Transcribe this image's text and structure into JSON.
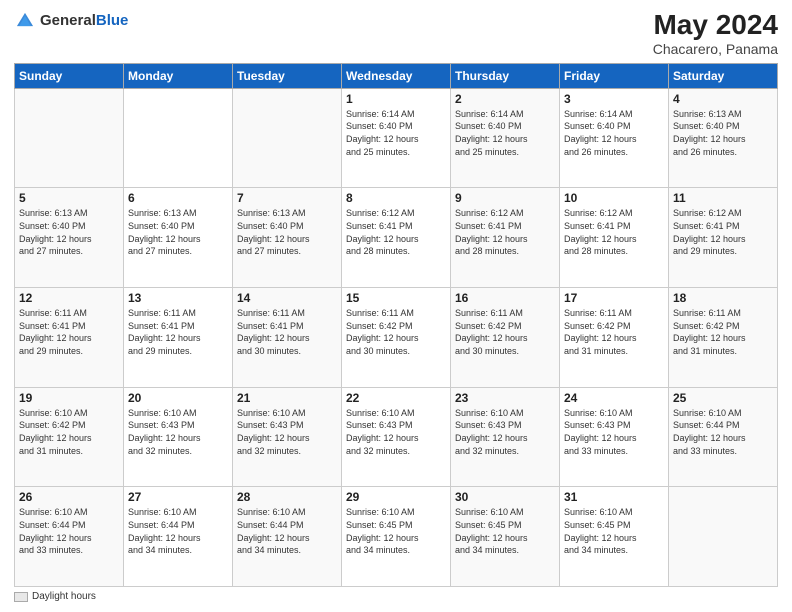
{
  "header": {
    "logo_line1": "General",
    "logo_line2": "Blue",
    "month": "May 2024",
    "location": "Chacarero, Panama"
  },
  "days_of_week": [
    "Sunday",
    "Monday",
    "Tuesday",
    "Wednesday",
    "Thursday",
    "Friday",
    "Saturday"
  ],
  "footer": {
    "legend_label": "Daylight hours"
  },
  "weeks": [
    [
      {
        "day": "",
        "info": ""
      },
      {
        "day": "",
        "info": ""
      },
      {
        "day": "",
        "info": ""
      },
      {
        "day": "1",
        "info": "Sunrise: 6:14 AM\nSunset: 6:40 PM\nDaylight: 12 hours\nand 25 minutes."
      },
      {
        "day": "2",
        "info": "Sunrise: 6:14 AM\nSunset: 6:40 PM\nDaylight: 12 hours\nand 25 minutes."
      },
      {
        "day": "3",
        "info": "Sunrise: 6:14 AM\nSunset: 6:40 PM\nDaylight: 12 hours\nand 26 minutes."
      },
      {
        "day": "4",
        "info": "Sunrise: 6:13 AM\nSunset: 6:40 PM\nDaylight: 12 hours\nand 26 minutes."
      }
    ],
    [
      {
        "day": "5",
        "info": "Sunrise: 6:13 AM\nSunset: 6:40 PM\nDaylight: 12 hours\nand 27 minutes."
      },
      {
        "day": "6",
        "info": "Sunrise: 6:13 AM\nSunset: 6:40 PM\nDaylight: 12 hours\nand 27 minutes."
      },
      {
        "day": "7",
        "info": "Sunrise: 6:13 AM\nSunset: 6:40 PM\nDaylight: 12 hours\nand 27 minutes."
      },
      {
        "day": "8",
        "info": "Sunrise: 6:12 AM\nSunset: 6:41 PM\nDaylight: 12 hours\nand 28 minutes."
      },
      {
        "day": "9",
        "info": "Sunrise: 6:12 AM\nSunset: 6:41 PM\nDaylight: 12 hours\nand 28 minutes."
      },
      {
        "day": "10",
        "info": "Sunrise: 6:12 AM\nSunset: 6:41 PM\nDaylight: 12 hours\nand 28 minutes."
      },
      {
        "day": "11",
        "info": "Sunrise: 6:12 AM\nSunset: 6:41 PM\nDaylight: 12 hours\nand 29 minutes."
      }
    ],
    [
      {
        "day": "12",
        "info": "Sunrise: 6:11 AM\nSunset: 6:41 PM\nDaylight: 12 hours\nand 29 minutes."
      },
      {
        "day": "13",
        "info": "Sunrise: 6:11 AM\nSunset: 6:41 PM\nDaylight: 12 hours\nand 29 minutes."
      },
      {
        "day": "14",
        "info": "Sunrise: 6:11 AM\nSunset: 6:41 PM\nDaylight: 12 hours\nand 30 minutes."
      },
      {
        "day": "15",
        "info": "Sunrise: 6:11 AM\nSunset: 6:42 PM\nDaylight: 12 hours\nand 30 minutes."
      },
      {
        "day": "16",
        "info": "Sunrise: 6:11 AM\nSunset: 6:42 PM\nDaylight: 12 hours\nand 30 minutes."
      },
      {
        "day": "17",
        "info": "Sunrise: 6:11 AM\nSunset: 6:42 PM\nDaylight: 12 hours\nand 31 minutes."
      },
      {
        "day": "18",
        "info": "Sunrise: 6:11 AM\nSunset: 6:42 PM\nDaylight: 12 hours\nand 31 minutes."
      }
    ],
    [
      {
        "day": "19",
        "info": "Sunrise: 6:10 AM\nSunset: 6:42 PM\nDaylight: 12 hours\nand 31 minutes."
      },
      {
        "day": "20",
        "info": "Sunrise: 6:10 AM\nSunset: 6:43 PM\nDaylight: 12 hours\nand 32 minutes."
      },
      {
        "day": "21",
        "info": "Sunrise: 6:10 AM\nSunset: 6:43 PM\nDaylight: 12 hours\nand 32 minutes."
      },
      {
        "day": "22",
        "info": "Sunrise: 6:10 AM\nSunset: 6:43 PM\nDaylight: 12 hours\nand 32 minutes."
      },
      {
        "day": "23",
        "info": "Sunrise: 6:10 AM\nSunset: 6:43 PM\nDaylight: 12 hours\nand 32 minutes."
      },
      {
        "day": "24",
        "info": "Sunrise: 6:10 AM\nSunset: 6:43 PM\nDaylight: 12 hours\nand 33 minutes."
      },
      {
        "day": "25",
        "info": "Sunrise: 6:10 AM\nSunset: 6:44 PM\nDaylight: 12 hours\nand 33 minutes."
      }
    ],
    [
      {
        "day": "26",
        "info": "Sunrise: 6:10 AM\nSunset: 6:44 PM\nDaylight: 12 hours\nand 33 minutes."
      },
      {
        "day": "27",
        "info": "Sunrise: 6:10 AM\nSunset: 6:44 PM\nDaylight: 12 hours\nand 34 minutes."
      },
      {
        "day": "28",
        "info": "Sunrise: 6:10 AM\nSunset: 6:44 PM\nDaylight: 12 hours\nand 34 minutes."
      },
      {
        "day": "29",
        "info": "Sunrise: 6:10 AM\nSunset: 6:45 PM\nDaylight: 12 hours\nand 34 minutes."
      },
      {
        "day": "30",
        "info": "Sunrise: 6:10 AM\nSunset: 6:45 PM\nDaylight: 12 hours\nand 34 minutes."
      },
      {
        "day": "31",
        "info": "Sunrise: 6:10 AM\nSunset: 6:45 PM\nDaylight: 12 hours\nand 34 minutes."
      },
      {
        "day": "",
        "info": ""
      }
    ]
  ]
}
